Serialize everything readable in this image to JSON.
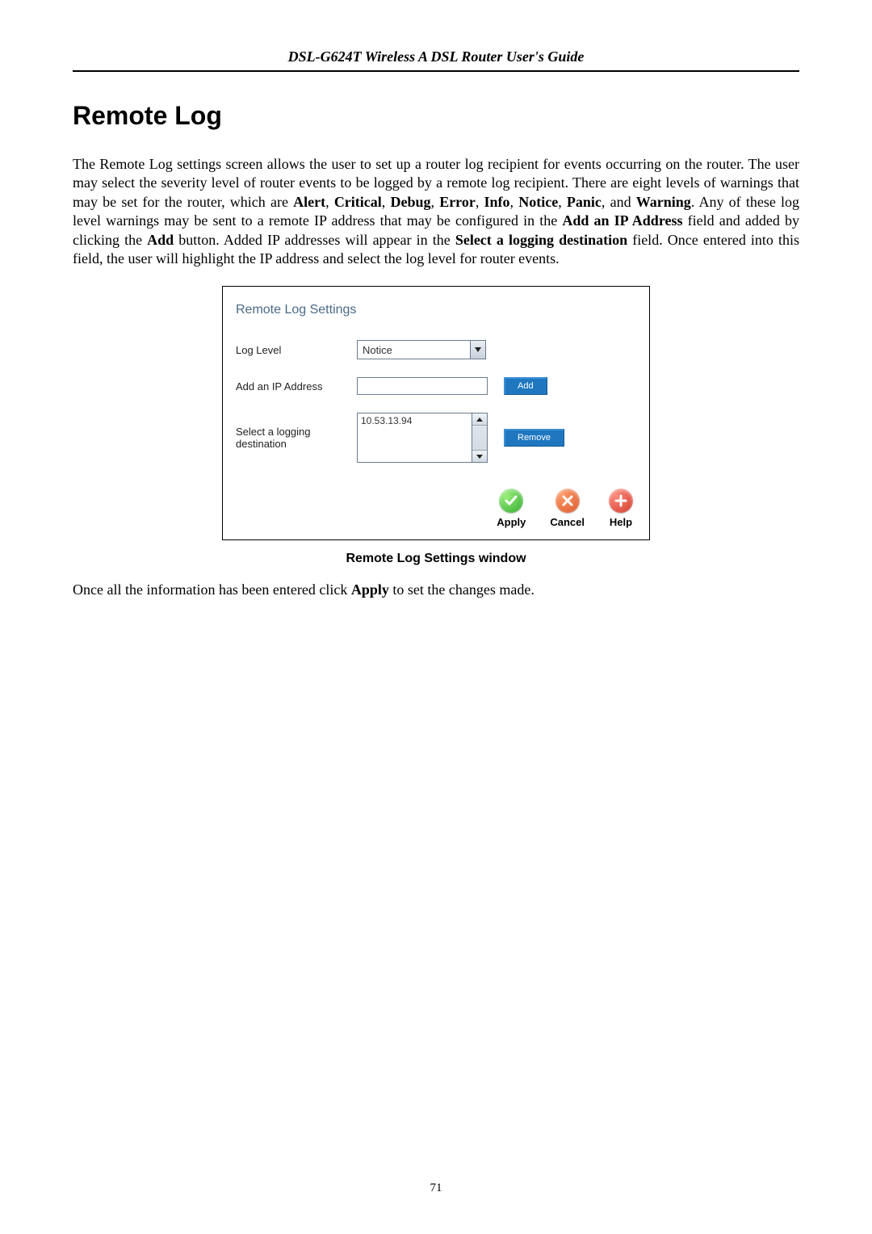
{
  "header": {
    "title": "DSL-G624T Wireless A DSL Router User's Guide"
  },
  "section": {
    "title": "Remote Log",
    "paragraph_html": "The Remote Log settings screen allows the user to set up a router log recipient for events occurring on the router. The user may select the severity level of router events to be logged by a remote log recipient. There are eight levels of warnings that may be set for the router, which are <b>Alert</b>, <b>Critical</b>, <b>Debug</b>, <b>Error</b>, <b>Info</b>, <b>Notice</b>, <b>Panic</b>, and <b>Warning</b>. Any of these log level warnings may be sent to a remote IP address that may be configured in the <b>Add an IP Address</b> field and added by clicking the <b>Add</b> button. Added IP addresses will appear in the <b>Select a logging destination</b> field. Once entered into this field, the user will highlight the IP address and select the log level for router events."
  },
  "panel": {
    "heading": "Remote Log Settings",
    "log_level_label": "Log Level",
    "log_level_value": "Notice",
    "add_ip_label": "Add an IP Address",
    "add_ip_value": "",
    "add_btn": "Add",
    "dest_label": "Select a logging destination",
    "destinations": [
      "10.53.13.94"
    ],
    "remove_btn": "Remove",
    "actions": {
      "apply": "Apply",
      "cancel": "Cancel",
      "help": "Help"
    }
  },
  "caption": "Remote Log Settings window",
  "tail_html": "Once all the information has been entered click <b>Apply</b> to set the changes made.",
  "page_number": "71"
}
